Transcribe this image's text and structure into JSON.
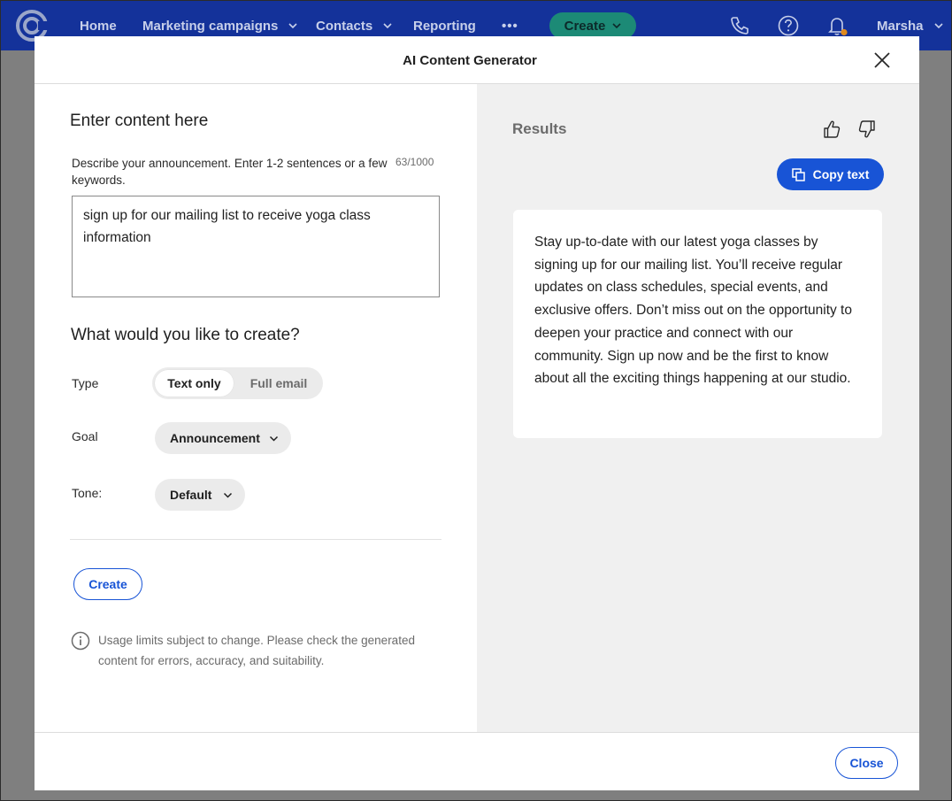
{
  "nav": {
    "items": [
      {
        "label": "Home"
      },
      {
        "label": "Marketing campaigns"
      },
      {
        "label": "Contacts"
      },
      {
        "label": "Reporting"
      }
    ],
    "more_label": "•••",
    "create_label": "Create",
    "user_name": "Marsha"
  },
  "modal": {
    "title": "AI Content Generator"
  },
  "input": {
    "heading": "Enter content here",
    "description_label": "Describe your announcement. Enter 1-2 sentences or a few keywords.",
    "char_count": "63/1000",
    "value": "sign up for our mailing list to receive yoga class information"
  },
  "options": {
    "heading": "What would you like to create?",
    "type_label": "Type",
    "type_options": [
      "Text only",
      "Full email"
    ],
    "type_selected": "Text only",
    "goal_label": "Goal",
    "goal_value": "Announcement",
    "tone_label": "Tone:",
    "tone_value": "Default",
    "create_button": "Create",
    "usage_note": "Usage limits subject to change. Please check the generated content for errors, accuracy, and suitability."
  },
  "results": {
    "heading": "Results",
    "copy_button": "Copy text",
    "text": "Stay up-to-date with our latest yoga classes by signing up for our mailing list. You’ll receive regular updates on class schedules, special events, and exclusive offers. Don’t miss out on the opportunity to deepen your practice and connect with our community. Sign up now and be the first to know about all the exciting things happening at our studio."
  },
  "footer": {
    "close_button": "Close"
  },
  "colors": {
    "nav_bg": "#14329a",
    "accent_blue": "#1854d6",
    "create_green": "#1c8a76",
    "overlay_grey": "#7f7f7f",
    "results_bg": "#f0f0f0",
    "notification_dot": "#e08a1e"
  }
}
